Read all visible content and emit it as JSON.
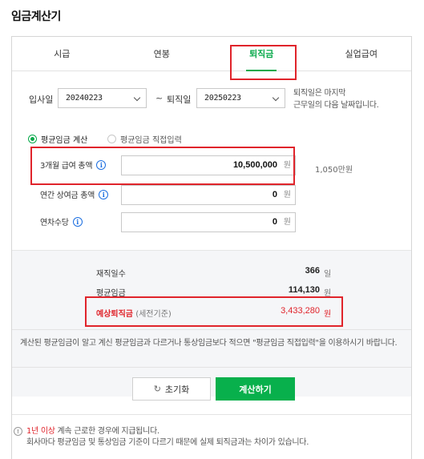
{
  "page_title": "임금계산기",
  "tabs": [
    {
      "label": "시급",
      "active": false
    },
    {
      "label": "연봉",
      "active": false
    },
    {
      "label": "퇴직금",
      "active": true
    },
    {
      "label": "실업급여",
      "active": false
    }
  ],
  "dates": {
    "start_label": "입사일",
    "start_value": "20240223",
    "separator": "~",
    "end_label": "퇴직일",
    "end_value": "20250223",
    "note_line1": "퇴직일은 마지막",
    "note_line2": "근무일의 다음 날짜입니다."
  },
  "mode": {
    "option1": "평균임금 계산",
    "option2": "평균임금 직접입력",
    "selected": "option1"
  },
  "fields": {
    "salary3m": {
      "label": "3개월 급여 총액",
      "value": "10,500,000",
      "unit": "원",
      "hint": "1,050만원"
    },
    "bonus": {
      "label": "연간 상여금 총액",
      "value": "0",
      "unit": "원"
    },
    "annual_leave": {
      "label": "연차수당",
      "value": "0",
      "unit": "원"
    }
  },
  "summary": {
    "days_label": "재직일수",
    "days_value": "366",
    "days_unit": "일",
    "avg_label": "평균임금",
    "avg_value": "114,130",
    "avg_unit": "원",
    "severance_label": "예상퇴직금",
    "severance_sub": "(세전기준)",
    "severance_value": "3,433,280",
    "severance_unit": "원"
  },
  "description": "계산된 평균임금이 알고 계신 평균임금과 다르거나 통상임금보다 적으면 \"평균임금 직접입력\"을 이용하시기 바랍니다.",
  "buttons": {
    "reset": "초기화",
    "calculate": "계산하기"
  },
  "footer": {
    "icon": "!",
    "line1_red": "1년 이상",
    "line1_rest": " 계속 근로한 경우에 지급됩니다.",
    "line2": "회사마다 평균임금 및 통상임금 기준이 다르기 때문에 실제 퇴직금과는 차이가 있습니다."
  },
  "colors": {
    "accent": "#07a94a",
    "highlight": "#e0242b",
    "info": "#1b6ee0"
  }
}
